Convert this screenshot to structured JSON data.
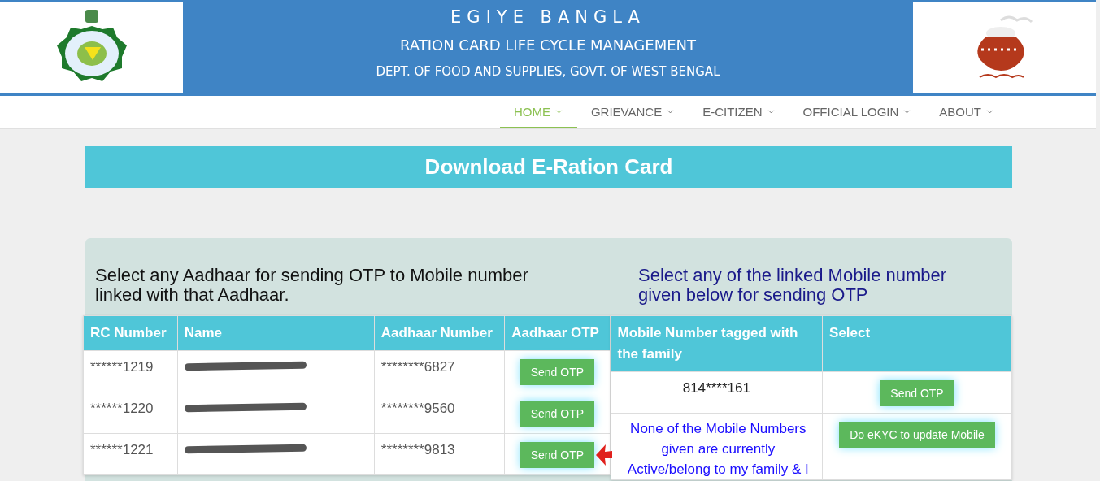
{
  "header": {
    "title": "EGIYE BANGLA",
    "subtitle": "RATION CARD LIFE CYCLE MANAGEMENT",
    "department": "DEPT. OF FOOD AND SUPPLIES, GOVT. OF WEST BENGAL"
  },
  "nav": [
    {
      "label": "HOME",
      "selected": true
    },
    {
      "label": "GRIEVANCE",
      "selected": false
    },
    {
      "label": "E-CITIZEN",
      "selected": false
    },
    {
      "label": "OFFICIAL LOGIN",
      "selected": false
    },
    {
      "label": "ABOUT",
      "selected": false
    }
  ],
  "banner": "Download E-Ration Card",
  "aadhaar_section": {
    "heading": "Select any Aadhaar for sending OTP to Mobile number linked with that Aadhaar.",
    "columns": [
      "RC Number",
      "Name",
      "Aadhaar Number",
      "Aadhaar OTP"
    ],
    "rows": [
      {
        "rc": "******1219",
        "name_redacted": true,
        "aadhaar": "********6827",
        "button": "Send OTP"
      },
      {
        "rc": "******1220",
        "name_redacted": true,
        "aadhaar": "********9560",
        "button": "Send OTP"
      },
      {
        "rc": "******1221",
        "name_redacted": true,
        "aadhaar": "********9813",
        "button": "Send OTP"
      }
    ]
  },
  "mobile_section": {
    "heading": "Select any of the linked Mobile number given below for sending OTP",
    "columns": [
      "Mobile Number tagged with the family",
      "Select"
    ],
    "rows": [
      {
        "kind": "number",
        "text": "814****161",
        "button": "Send OTP"
      },
      {
        "kind": "notice",
        "text": "None of the Mobile Numbers given are currently Active/belong to my family & I",
        "button": "Do eKYC to update Mobile"
      }
    ]
  },
  "annotation": {
    "kind": "arrow"
  }
}
